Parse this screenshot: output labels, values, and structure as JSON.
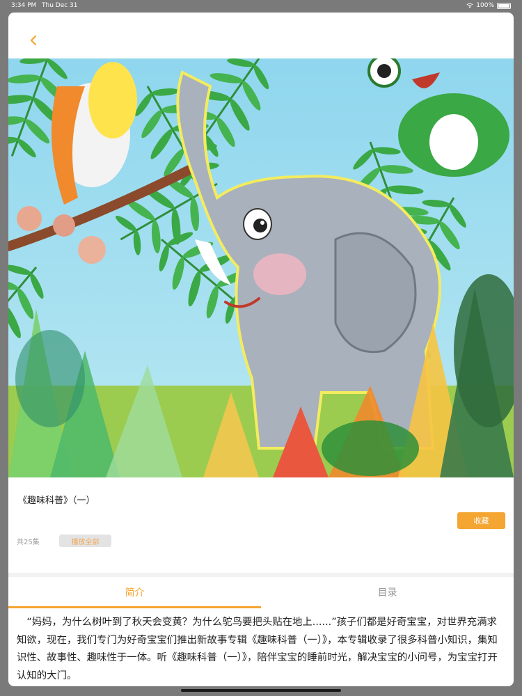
{
  "status_bar": {
    "time": "3:34 PM",
    "date": "Thu Dec 31",
    "battery": "100%"
  },
  "nav": {
    "back_icon": "chevron-left-icon"
  },
  "album": {
    "title": "《趣味科普》（一）",
    "favorite_label": "收藏",
    "episode_count": "共25集",
    "play_all_label": "播放全部"
  },
  "tabs": [
    {
      "label": "简介",
      "active": true
    },
    {
      "label": "目录",
      "active": false
    }
  ],
  "intro_text": "“妈妈，为什么树叶到了秋天会变黄？为什么鸵鸟要把头贴在地上......”孩子们都是好奇宝宝，对世界充满求知欲，现在，我们专门为好奇宝宝们推出新故事专辑《趣味科普（一）》，本专辑收录了很多科普小知识，集知识性、故事性、趣味性于一体。听《趣味科普（一）》，陪伴宝宝的睡前时光，解决宝宝的小问号，为宝宝打开认知的大门。",
  "colors": {
    "accent": "#f5a531",
    "tab_inactive": "#999999",
    "text": "#222222",
    "muted": "#9a9a9a"
  }
}
